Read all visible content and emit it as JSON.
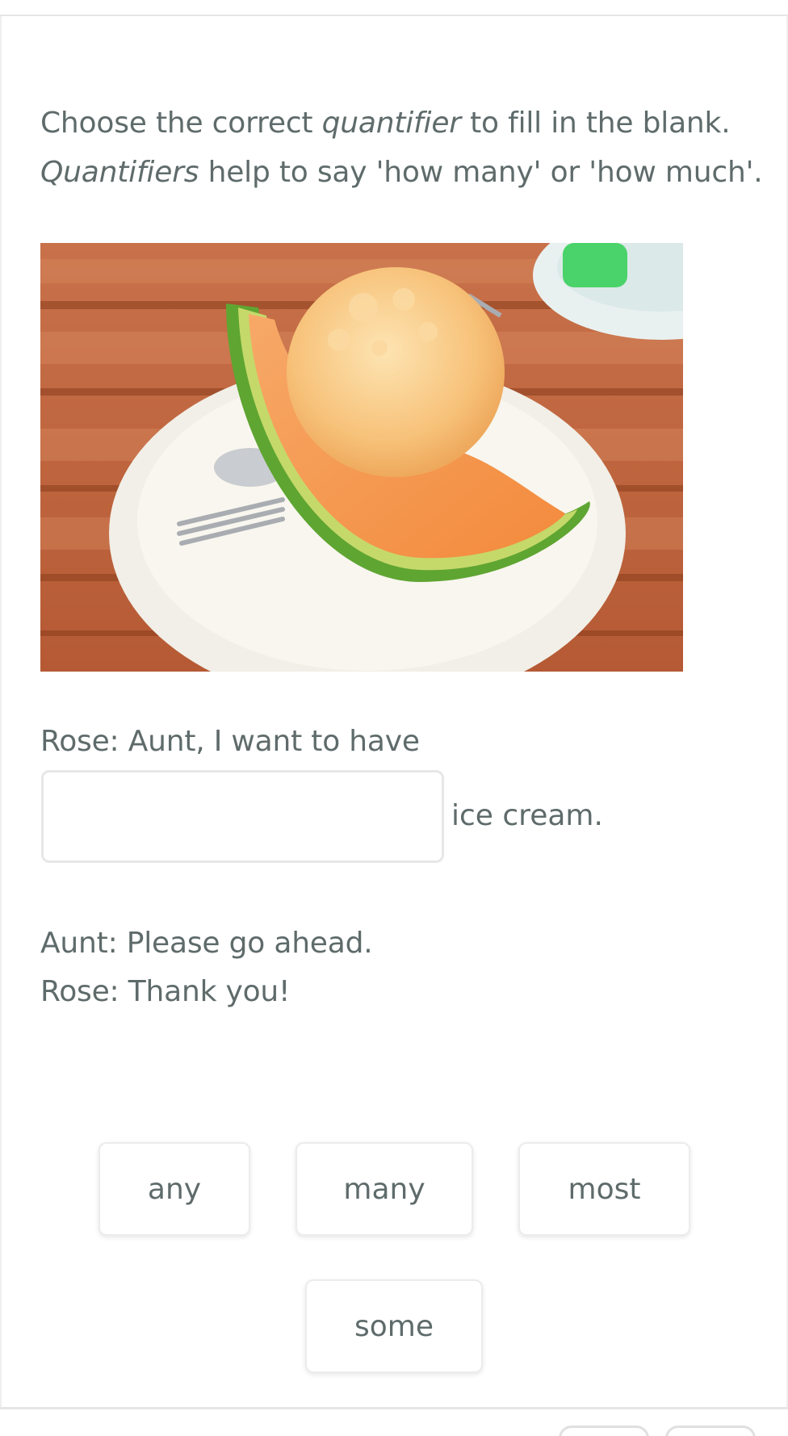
{
  "instructions": {
    "line1_a": "Choose the correct ",
    "line1_em": "quantifier",
    "line1_b": " to fill in the blank.",
    "line2_em": "Quantifiers",
    "line2_b": " help to say 'how many' or 'how much'."
  },
  "dialogue": {
    "line1": "Rose: Aunt, I want to have",
    "blank_value": "",
    "after_blank": "ice cream.",
    "line2": "Aunt: Please go ahead.",
    "line3": "Rose: Thank you!"
  },
  "options": [
    "any",
    "many",
    "most",
    "some"
  ],
  "colors": {
    "text": "#5f6b6b",
    "border": "#e7e7e7"
  }
}
